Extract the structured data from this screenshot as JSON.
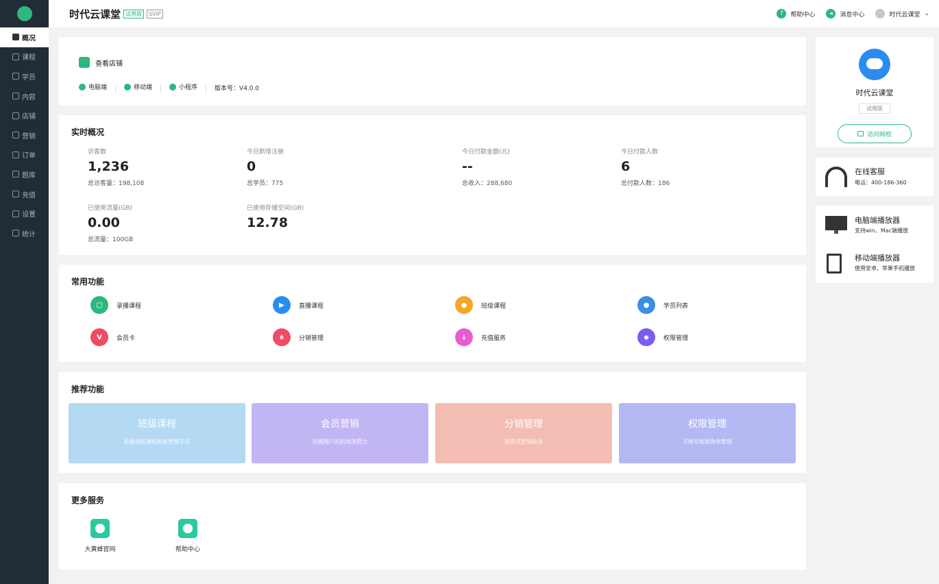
{
  "sidebar": {
    "items": [
      {
        "label": "概况",
        "icon": "overview-icon"
      },
      {
        "label": "课程",
        "icon": "course-icon"
      },
      {
        "label": "学员",
        "icon": "student-icon"
      },
      {
        "label": "内容",
        "icon": "content-icon"
      },
      {
        "label": "店铺",
        "icon": "store-icon"
      },
      {
        "label": "营销",
        "icon": "tag-icon"
      },
      {
        "label": "订单",
        "icon": "order-icon"
      },
      {
        "label": "题库",
        "icon": "pen-icon"
      },
      {
        "label": "充值",
        "icon": "yen-icon"
      },
      {
        "label": "设置",
        "icon": "gear-icon"
      },
      {
        "label": "统计",
        "icon": "bar-chart-icon"
      }
    ]
  },
  "header": {
    "title": "时代云课堂",
    "tag_trial": "试用版",
    "tag_svip": "SVIP",
    "help": "帮助中心",
    "messages": "消息中心",
    "user": "时代云课堂"
  },
  "store": {
    "view_store": "查看店铺",
    "pc": "电脑端",
    "mobile": "移动端",
    "mini": "小程序",
    "version": "版本号：V4.0.0"
  },
  "realtime": {
    "title": "实时概况",
    "stats": [
      {
        "label": "访客数",
        "value": "1,236",
        "sub": "总访客量：198,108"
      },
      {
        "label": "今日新增注册",
        "value": "0",
        "sub": "总学员：775"
      },
      {
        "label": "今日付款金额(元)",
        "value": "--",
        "sub": "总收入：288,680"
      },
      {
        "label": "今日付款人数",
        "value": "6",
        "sub": "总付款人数：186"
      },
      {
        "label": "已使用流量(GB)",
        "value": "0.00",
        "sub": "总流量：100GB"
      },
      {
        "label": "已使用存储空间(GB)",
        "value": "12.78",
        "sub": ""
      }
    ]
  },
  "common": {
    "title": "常用功能",
    "items": [
      {
        "label": "录播课程",
        "color": "#2db77e"
      },
      {
        "label": "直播课程",
        "color": "#2b8cf0"
      },
      {
        "label": "班级课程",
        "color": "#f5a623"
      },
      {
        "label": "学员列表",
        "color": "#3a8ee6"
      },
      {
        "label": "会员卡",
        "color": "#f04b63"
      },
      {
        "label": "分销管理",
        "color": "#f04b63"
      },
      {
        "label": "充值服务",
        "color": "#e85bd2"
      },
      {
        "label": "权限管理",
        "color": "#7b5cf0"
      }
    ]
  },
  "recommend": {
    "title": "推荐功能",
    "items": [
      {
        "title": "班级课程",
        "desc": "批量授权课程批量管理学员",
        "color": "#b4d9f3"
      },
      {
        "title": "会员营销",
        "desc": "挖掘用户的后续消费力",
        "color": "#c2b5f3"
      },
      {
        "title": "分销管理",
        "desc": "裂变式营销玩法",
        "color": "#f3bdb3"
      },
      {
        "title": "权限管理",
        "desc": "子账号权限角色管理",
        "color": "#b4b9f3"
      }
    ]
  },
  "more": {
    "title": "更多服务",
    "items": [
      {
        "label": "大黄蜂官网"
      },
      {
        "label": "帮助中心"
      }
    ]
  },
  "profile": {
    "name": "时代云课堂",
    "badge": "试用版",
    "visit": "访问网校"
  },
  "support": {
    "title": "在线客服",
    "phone": "电话：400-186-360"
  },
  "players": [
    {
      "title": "电脑端播放器",
      "desc": "支持win、Mac端播放"
    },
    {
      "title": "移动端播放器",
      "desc": "使用安卓、苹果手机播放"
    }
  ],
  "colors": {
    "brand": "#2db77e",
    "sidebar": "#222c36"
  }
}
